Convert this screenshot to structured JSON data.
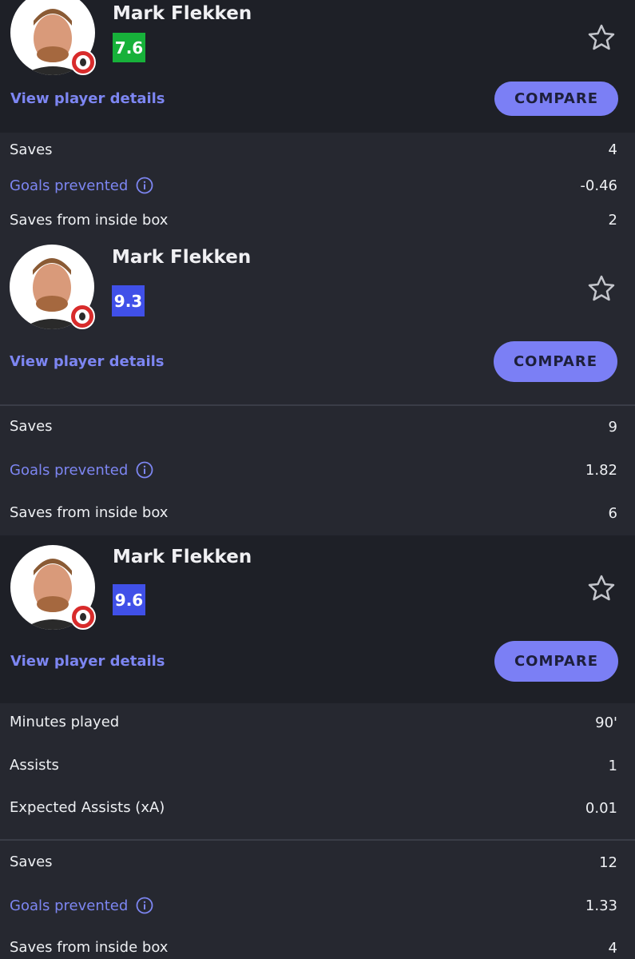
{
  "colors": {
    "background": "#262830",
    "card_background": "#1e2027",
    "accent": "#7d86f2",
    "button": "#7b7ff5",
    "rating_green": "#17b13a",
    "rating_blue": "#4050e8"
  },
  "cards": [
    {
      "player_name": "Mark Flekken",
      "rating": "7.6",
      "rating_color": "#17b13a",
      "details_link": "View player details",
      "compare_label": "COMPARE",
      "favorite_icon": "star-outline-icon"
    },
    {
      "player_name": "Mark Flekken",
      "rating": "9.3",
      "rating_color": "#4050e8",
      "details_link": "View player details",
      "compare_label": "COMPARE",
      "favorite_icon": "star-outline-icon"
    },
    {
      "player_name": "Mark Flekken",
      "rating": "9.6",
      "rating_color": "#4050e8",
      "details_link": "View player details",
      "compare_label": "COMPARE",
      "favorite_icon": "star-outline-icon"
    }
  ],
  "stats_1": [
    {
      "label": "Saves",
      "value": "4"
    },
    {
      "label": "Goals prevented",
      "value": "-0.46"
    },
    {
      "label": "Saves from inside box",
      "value": "2"
    }
  ],
  "stats_2": [
    {
      "label": "Saves",
      "value": "9"
    },
    {
      "label": "Goals prevented",
      "value": "1.82"
    },
    {
      "label": "Saves from inside box",
      "value": "6"
    }
  ],
  "stats_3": [
    {
      "label": "Minutes played",
      "value": "90'"
    },
    {
      "label": "Assists",
      "value": "1"
    },
    {
      "label": "Expected Assists (xA)",
      "value": "0.01"
    }
  ],
  "stats_4": [
    {
      "label": "Saves",
      "value": "12"
    },
    {
      "label": "Goals prevented",
      "value": "1.33"
    },
    {
      "label": "Saves from inside box",
      "value": "4"
    }
  ]
}
